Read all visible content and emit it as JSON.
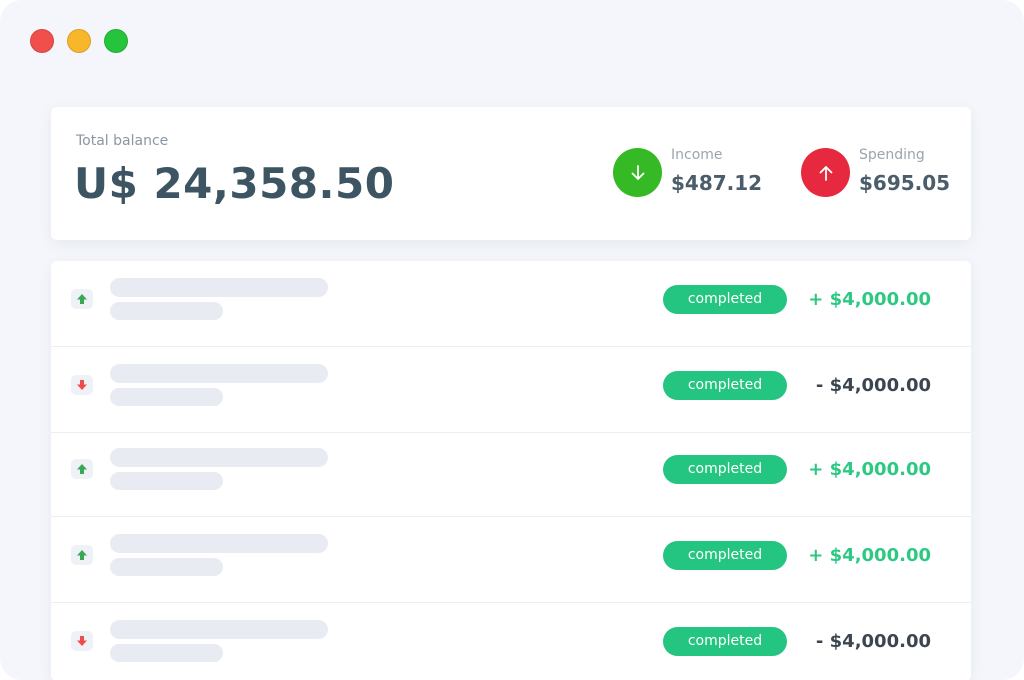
{
  "window": {
    "controls": [
      "close",
      "minimize",
      "maximize"
    ]
  },
  "summary": {
    "balance_label": "Total balance",
    "balance_value": "U$ 24,358.50",
    "income": {
      "label": "Income",
      "value": "$487.12",
      "icon": "arrow-down-icon",
      "color": "#35b925"
    },
    "spending": {
      "label": "Spending",
      "value": "$695.05",
      "icon": "arrow-up-icon",
      "color": "#e6293f"
    }
  },
  "transactions": [
    {
      "direction": "in",
      "status": "completed",
      "amount": "+ $4,000.00"
    },
    {
      "direction": "out",
      "status": "completed",
      "amount": "- $4,000.00"
    },
    {
      "direction": "in",
      "status": "completed",
      "amount": "+ $4,000.00"
    },
    {
      "direction": "in",
      "status": "completed",
      "amount": "+ $4,000.00"
    },
    {
      "direction": "out",
      "status": "completed",
      "amount": "- $4,000.00"
    }
  ],
  "colors": {
    "status_badge": "#24c580",
    "positive_amount": "#2dc983",
    "negative_amount": "#3b4650",
    "arrow_in": "#3aa757",
    "arrow_out": "#ea4e4e"
  }
}
